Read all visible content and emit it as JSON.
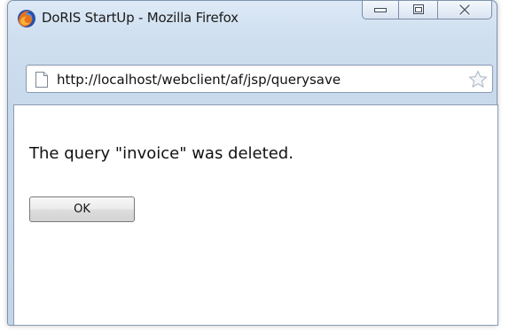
{
  "window": {
    "title": "DoRIS StartUp - Mozilla Firefox",
    "app_icon": "firefox-icon",
    "controls": {
      "minimize_icon": "minimize-icon",
      "maximize_icon": "maximize-icon",
      "close_icon": "close-icon"
    }
  },
  "address_bar": {
    "url": "http://localhost/webclient/af/jsp/querysave",
    "page_icon": "page-icon",
    "bookmark_icon": "star-icon"
  },
  "dialog": {
    "message": "The query \"invoice\" was deleted.",
    "ok_label": "OK"
  },
  "colors": {
    "frame": "#c8d9ec",
    "frame_border": "#7f93ad",
    "content_bg": "#ffffff"
  }
}
